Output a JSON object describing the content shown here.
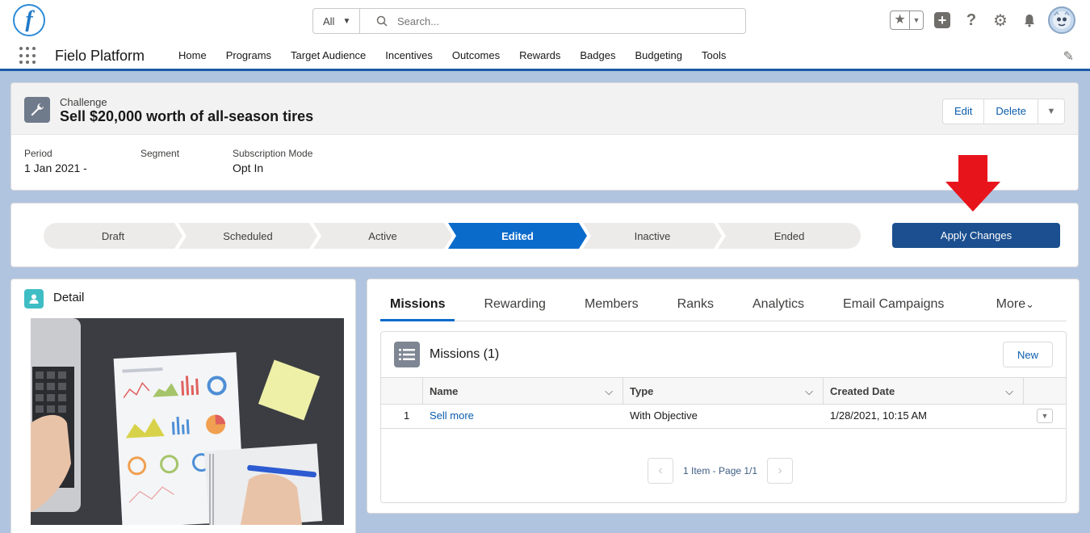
{
  "header": {
    "search_scope": "All",
    "search_placeholder": "Search..."
  },
  "nav": {
    "app_name": "Fielo Platform",
    "items": [
      "Home",
      "Programs",
      "Target Audience",
      "Incentives",
      "Outcomes",
      "Rewards",
      "Badges",
      "Budgeting",
      "Tools"
    ]
  },
  "record": {
    "object_type": "Challenge",
    "title": "Sell $20,000 worth of all-season tires",
    "actions": {
      "edit": "Edit",
      "delete": "Delete"
    },
    "fields": [
      {
        "label": "Period",
        "value": "1 Jan 2021 -"
      },
      {
        "label": "Segment",
        "value": ""
      },
      {
        "label": "Subscription Mode",
        "value": "Opt In"
      }
    ]
  },
  "path": {
    "stages": [
      "Draft",
      "Scheduled",
      "Active",
      "Edited",
      "Inactive",
      "Ended"
    ],
    "current": "Edited",
    "apply_label": "Apply Changes"
  },
  "detail": {
    "title": "Detail"
  },
  "tabs": {
    "items": [
      "Missions",
      "Rewarding",
      "Members",
      "Ranks",
      "Analytics",
      "Email Campaigns"
    ],
    "active": "Missions",
    "more": "More"
  },
  "missions": {
    "title": "Missions (1)",
    "new_label": "New",
    "columns": [
      "Name",
      "Type",
      "Created Date"
    ],
    "rows": [
      {
        "num": "1",
        "name": "Sell more",
        "type": "With Objective",
        "created": "1/28/2021, 10:15 AM"
      }
    ],
    "pager_text": "1 Item - Page 1/1"
  },
  "colors": {
    "brand": "#1b5aa6",
    "path_active": "#0b6bcb",
    "apply_button": "#1b4f8f",
    "arrow": "#e8141c"
  }
}
